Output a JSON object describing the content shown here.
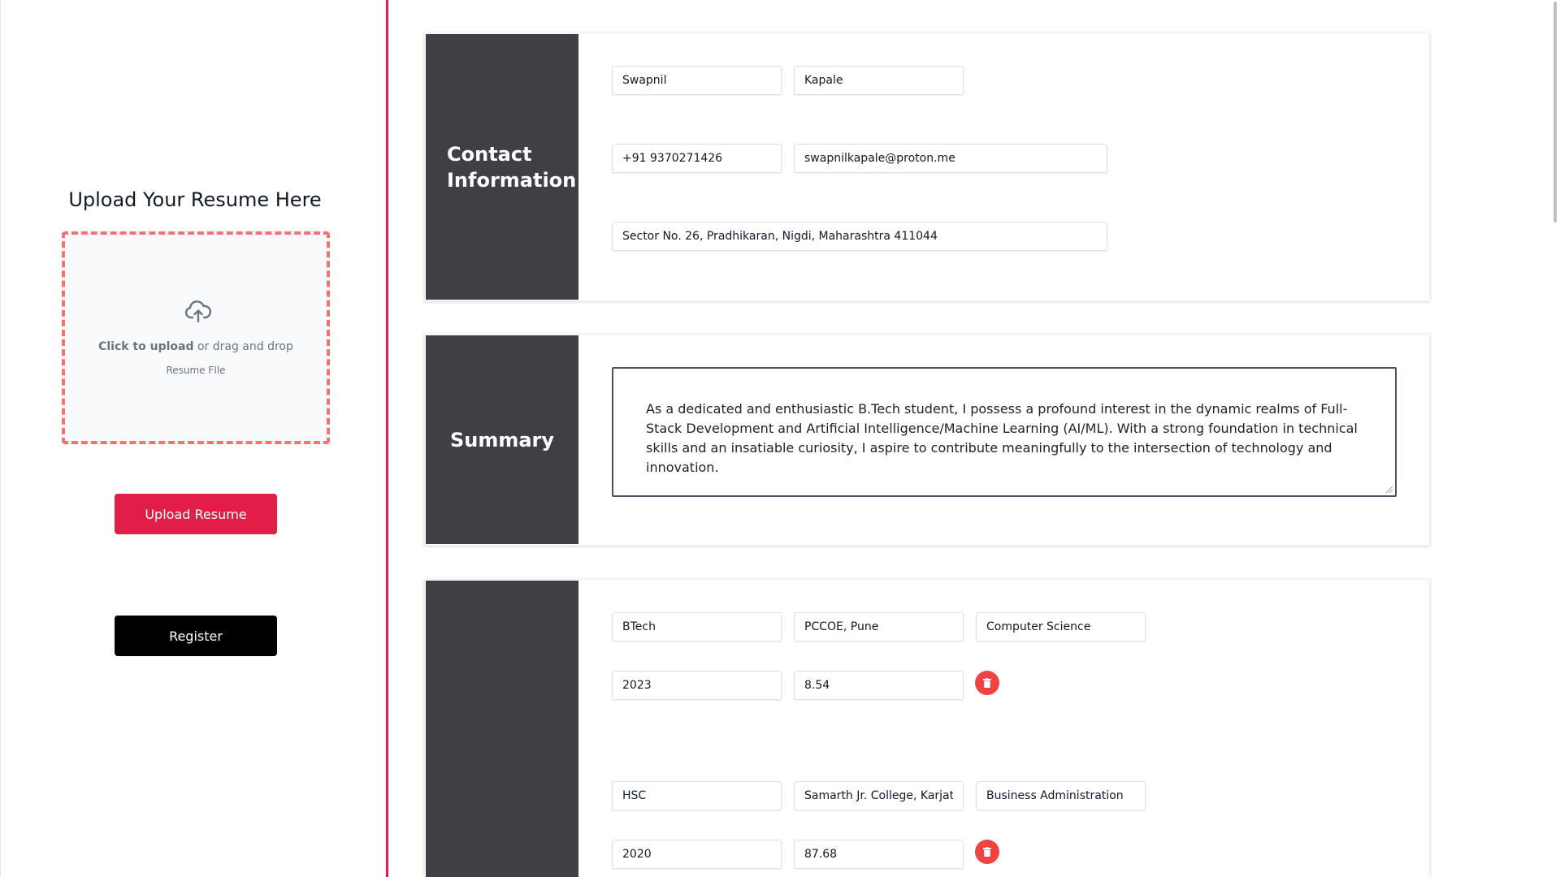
{
  "upload": {
    "title": "Upload Your Resume Here",
    "click_text": "Click to upload",
    "drag_text": " or drag and drop",
    "file_hint": "Resume FIle",
    "upload_button": "Upload Resume",
    "register_button": "Register"
  },
  "contact": {
    "section_title_line1": "Contact",
    "section_title_line2": "Information",
    "first_name": "Swapnil",
    "last_name": "Kapale",
    "phone": "+91 9370271426",
    "email": "swapnilkapale@proton.me",
    "address": "Sector No. 26, Pradhikaran, Nigdi, Maharashtra 411044"
  },
  "summary": {
    "section_title": "Summary",
    "text": "As a dedicated and enthusiastic B.Tech student, I possess a profound interest in the dynamic realms of Full-Stack Development and Artificial Intelligence/Machine Learning (AI/ML). With a strong foundation in technical skills and an insatiable curiosity, I aspire to contribute meaningfully to the intersection of technology and innovation."
  },
  "education": {
    "entries": [
      {
        "degree": "BTech",
        "institution": "PCCOE, Pune",
        "field": "Computer Science",
        "year": "2023",
        "score": "8.54"
      },
      {
        "degree": "HSC",
        "institution": "Samarth Jr. College, Karjat",
        "field": "Business Administration",
        "year": "2020",
        "score": "87.68"
      }
    ]
  },
  "colors": {
    "accent": "#e11d48",
    "sidebar": "#3f4045",
    "delete": "#ef4444"
  }
}
